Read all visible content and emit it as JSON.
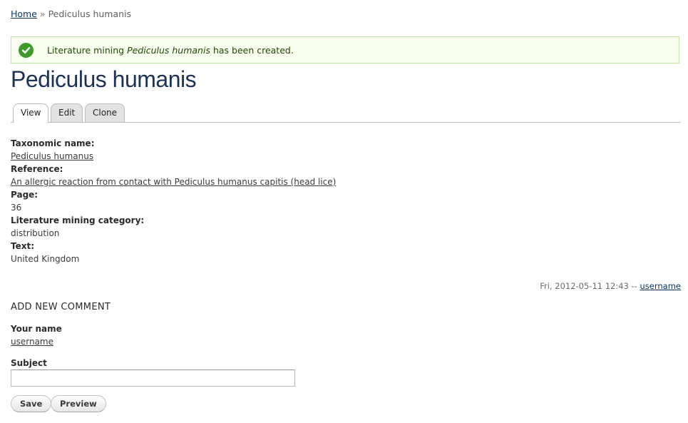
{
  "breadcrumb": {
    "home": "Home",
    "separator": "»",
    "current": "Pediculus humanis"
  },
  "message": {
    "icon": "check-icon",
    "prefix": "Literature mining ",
    "title": "Pediculus humanis",
    "suffix": " has been created.",
    "colors": {
      "background": "#f8fff0",
      "border": "#bee4a4",
      "icon": "#3d9a2b"
    }
  },
  "page_title": "Pediculus humanis",
  "tabs": [
    {
      "label": "View",
      "active": true
    },
    {
      "label": "Edit",
      "active": false
    },
    {
      "label": "Clone",
      "active": false
    }
  ],
  "fields": {
    "taxonomic_name": {
      "label": "Taxonomic name:",
      "value": "Pediculus humanus"
    },
    "reference": {
      "label": "Reference:",
      "value": "An allergic reaction from contact with Pediculus humanus capitis (head lice)"
    },
    "page": {
      "label": "Page:",
      "value": "36"
    },
    "category": {
      "label": "Literature mining category:",
      "value": "distribution"
    },
    "text": {
      "label": "Text:",
      "value": "United Kingdom"
    }
  },
  "submitted": {
    "date": "Fri, 2012-05-11 12:43 --",
    "user": "username"
  },
  "comment_form": {
    "heading": "ADD NEW COMMENT",
    "name_label": "Your name",
    "name_value": "username",
    "subject_label": "Subject",
    "subject_value": "",
    "save_label": "Save",
    "preview_label": "Preview"
  }
}
